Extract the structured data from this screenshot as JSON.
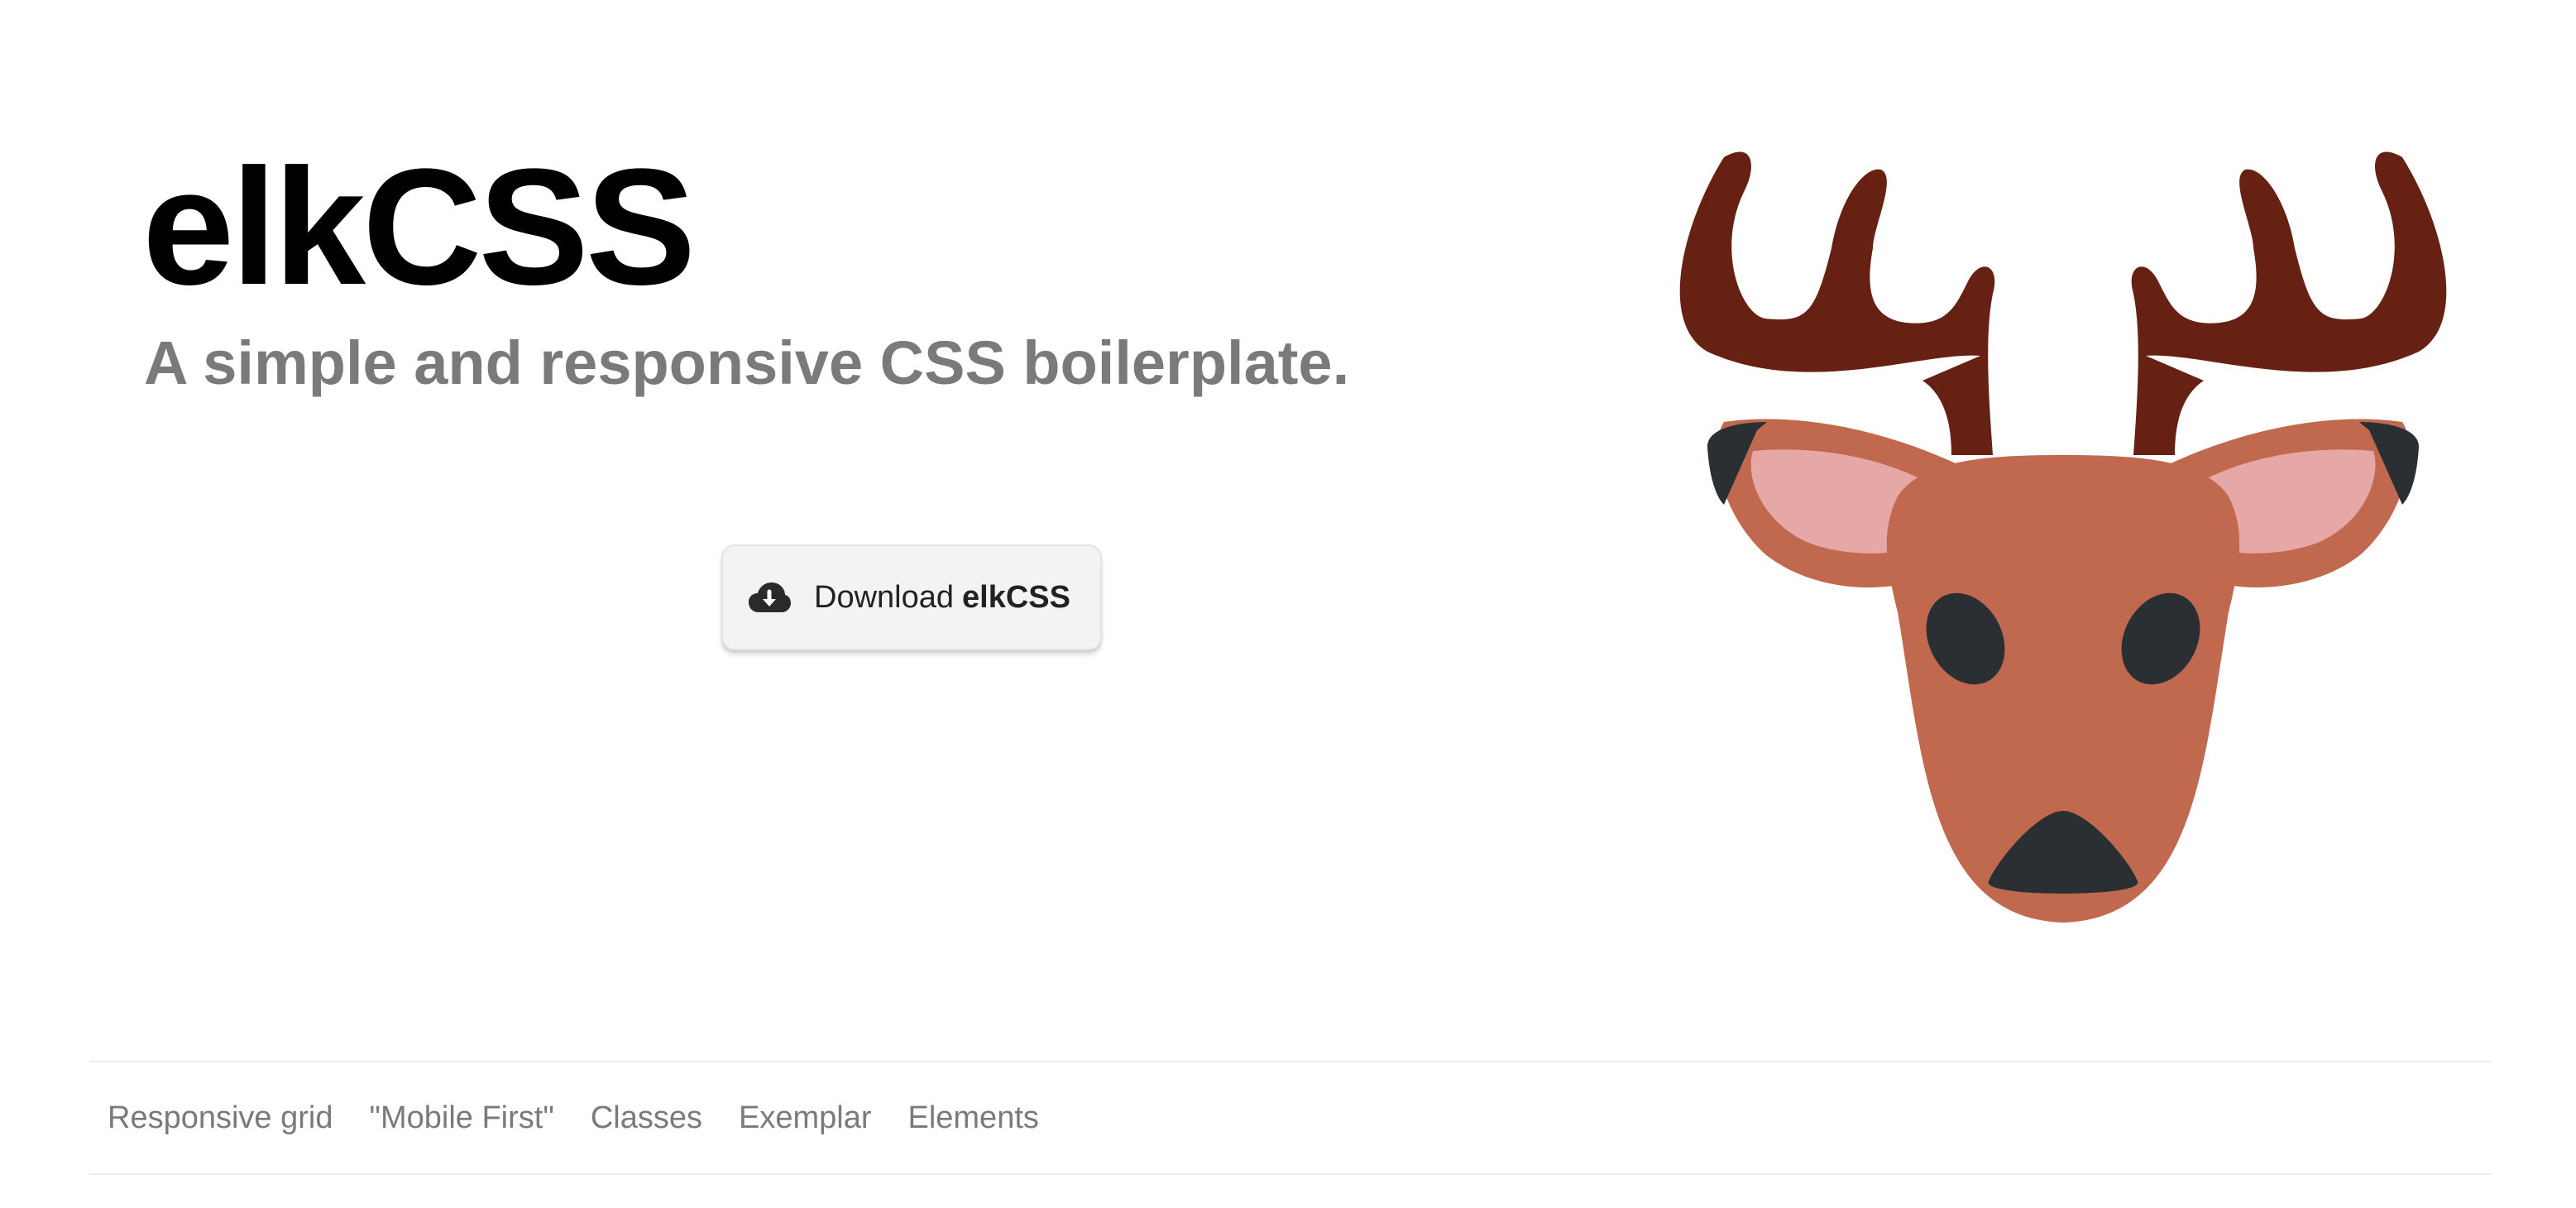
{
  "hero": {
    "title": "elkCSS",
    "subtitle": "A simple and responsive CSS boilerplate."
  },
  "download_button": {
    "label_prefix": "Download",
    "label_strong": "elkCSS",
    "icon": "cloud-download-icon"
  },
  "mascot": {
    "icon": "deer-head-icon",
    "colors": {
      "antler": "#662113",
      "face": "#c1694f",
      "inner_ear": "#e6a8a6",
      "dark": "#292f33"
    }
  },
  "nav": {
    "items": [
      {
        "label": "Responsive grid"
      },
      {
        "label": "\"Mobile First\""
      },
      {
        "label": "Classes"
      },
      {
        "label": "Exemplar"
      },
      {
        "label": "Elements"
      }
    ]
  }
}
